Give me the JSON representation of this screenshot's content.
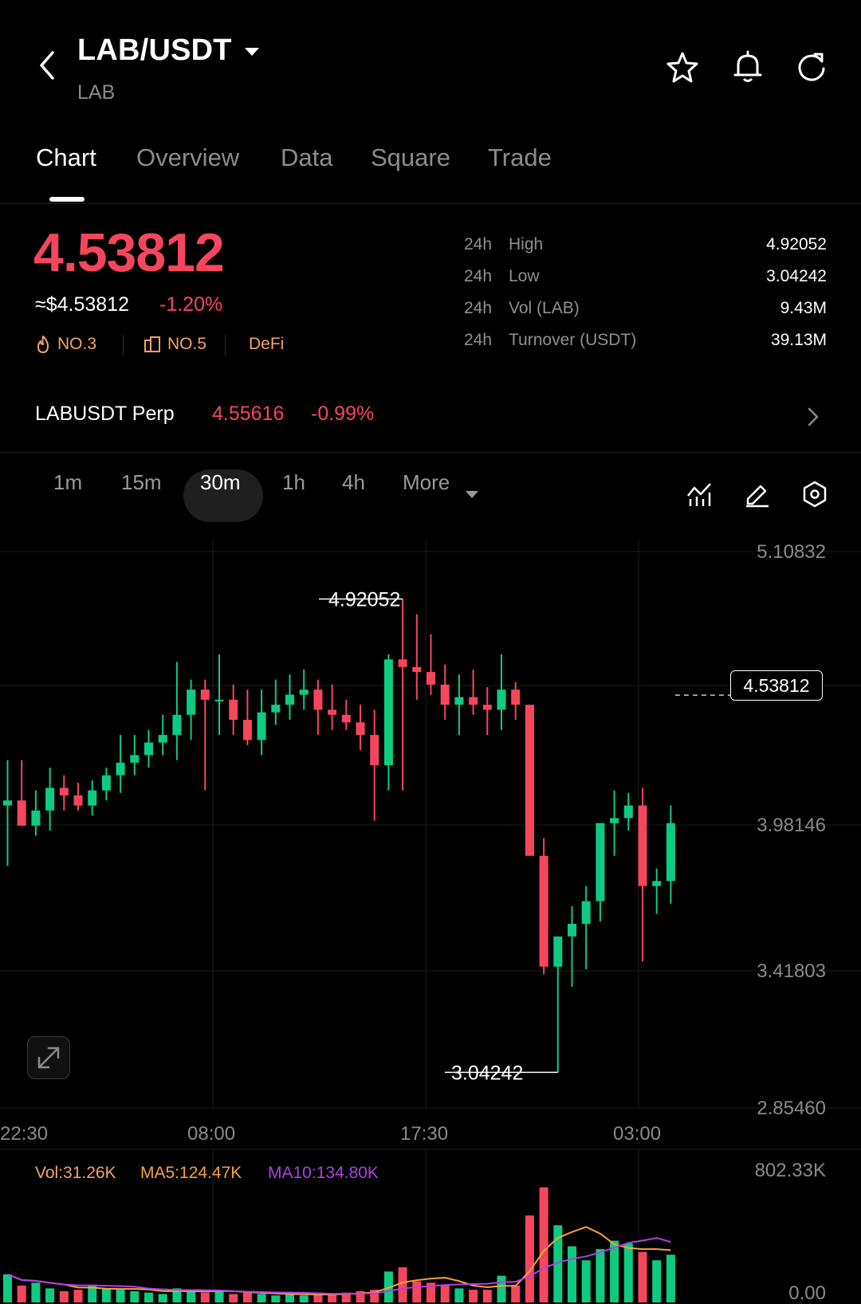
{
  "header": {
    "pair": "LAB/USDT",
    "base": "LAB",
    "icons": [
      "back-icon",
      "star-icon",
      "bell-icon",
      "refresh-icon"
    ]
  },
  "tabs": [
    "Chart",
    "Overview",
    "Data",
    "Square",
    "Trade"
  ],
  "active_tab": "Chart",
  "ticker": {
    "last": "4.53812",
    "usd": "≈$4.53812",
    "change": "-1.20%",
    "badges": [
      {
        "icon": "flame-icon",
        "label": "NO.3"
      },
      {
        "icon": "chart-box-icon",
        "label": "NO.5"
      },
      {
        "icon": "",
        "label": "DeFi"
      }
    ],
    "stats": [
      {
        "period": "24h",
        "label": "High",
        "value": "4.92052"
      },
      {
        "period": "24h",
        "label": "Low",
        "value": "3.04242"
      },
      {
        "period": "24h",
        "label": "Vol (LAB)",
        "value": "9.43M"
      },
      {
        "period": "24h",
        "label": "Turnover (USDT)",
        "value": "39.13M"
      }
    ]
  },
  "perp": {
    "name": "LABUSDT Perp",
    "price": "4.55616",
    "change": "-0.99%"
  },
  "timeframes": [
    "1m",
    "15m",
    "30m",
    "1h",
    "4h",
    "More"
  ],
  "active_timeframe": "30m",
  "colors": {
    "up": "#0ecb81",
    "down": "#f6465d",
    "bg": "#000000",
    "accent_badge": "#f2a36a",
    "ma5": "#f7a23b",
    "ma10": "#b13ee8"
  },
  "chart_data": [
    {
      "type": "candlestick",
      "y_ticks": [
        "5.10832",
        "3.98146",
        "3.41803",
        "2.85460"
      ],
      "x_ticks": [
        "22:30",
        "08:00",
        "17:30",
        "03:00"
      ],
      "ylim": [
        2.8546,
        5.10832
      ],
      "high_label": "4.92052",
      "low_label": "3.04242",
      "current_price": "4.53812",
      "grid": true,
      "candles": [
        [
          4.1,
          4.28,
          3.86,
          4.12
        ],
        [
          4.12,
          4.28,
          4.02,
          4.02
        ],
        [
          4.02,
          4.16,
          3.98,
          4.08
        ],
        [
          4.08,
          4.25,
          4.0,
          4.17
        ],
        [
          4.17,
          4.22,
          4.08,
          4.14
        ],
        [
          4.14,
          4.19,
          4.08,
          4.1
        ],
        [
          4.1,
          4.2,
          4.06,
          4.16
        ],
        [
          4.16,
          4.25,
          4.12,
          4.22
        ],
        [
          4.22,
          4.38,
          4.15,
          4.27
        ],
        [
          4.27,
          4.38,
          4.22,
          4.3
        ],
        [
          4.3,
          4.4,
          4.25,
          4.35
        ],
        [
          4.35,
          4.46,
          4.3,
          4.38
        ],
        [
          4.38,
          4.67,
          4.28,
          4.46
        ],
        [
          4.46,
          4.6,
          4.36,
          4.56
        ],
        [
          4.56,
          4.6,
          4.16,
          4.52
        ],
        [
          4.52,
          4.7,
          4.38,
          4.52
        ],
        [
          4.52,
          4.58,
          4.38,
          4.44
        ],
        [
          4.44,
          4.56,
          4.34,
          4.36
        ],
        [
          4.36,
          4.56,
          4.3,
          4.47
        ],
        [
          4.47,
          4.6,
          4.42,
          4.5
        ],
        [
          4.5,
          4.62,
          4.44,
          4.54
        ],
        [
          4.54,
          4.64,
          4.48,
          4.56
        ],
        [
          4.56,
          4.6,
          4.38,
          4.48
        ],
        [
          4.48,
          4.58,
          4.4,
          4.46
        ],
        [
          4.46,
          4.52,
          4.4,
          4.43
        ],
        [
          4.43,
          4.5,
          4.32,
          4.38
        ],
        [
          4.38,
          4.48,
          4.04,
          4.26
        ],
        [
          4.26,
          4.7,
          4.16,
          4.68
        ],
        [
          4.68,
          4.92,
          4.16,
          4.65
        ],
        [
          4.65,
          4.86,
          4.52,
          4.63
        ],
        [
          4.63,
          4.78,
          4.54,
          4.58
        ],
        [
          4.58,
          4.66,
          4.44,
          4.5
        ],
        [
          4.5,
          4.62,
          4.38,
          4.53
        ],
        [
          4.53,
          4.64,
          4.46,
          4.5
        ],
        [
          4.5,
          4.57,
          4.38,
          4.48
        ],
        [
          4.48,
          4.7,
          4.4,
          4.56
        ],
        [
          4.56,
          4.59,
          4.44,
          4.5
        ],
        [
          4.5,
          4.4,
          3.9,
          3.9
        ],
        [
          3.9,
          3.97,
          3.43,
          3.46
        ],
        [
          3.46,
          3.58,
          3.04,
          3.58
        ],
        [
          3.58,
          3.7,
          3.38,
          3.63
        ],
        [
          3.63,
          3.78,
          3.45,
          3.72
        ],
        [
          3.72,
          4.02,
          3.64,
          4.03
        ],
        [
          4.03,
          4.16,
          3.9,
          4.05
        ],
        [
          4.05,
          4.15,
          4.0,
          4.1
        ],
        [
          4.1,
          4.17,
          3.48,
          3.78
        ],
        [
          3.78,
          3.85,
          3.67,
          3.8
        ],
        [
          3.8,
          4.1,
          3.71,
          4.03
        ]
      ],
      "volumes": [
        [
          0.2
        ],
        [
          0.12
        ],
        [
          0.14
        ],
        [
          0.1
        ],
        [
          0.08
        ],
        [
          0.09
        ],
        [
          0.12
        ],
        [
          0.1
        ],
        [
          0.09
        ],
        [
          0.08
        ],
        [
          0.07
        ],
        [
          0.06
        ],
        [
          0.1
        ],
        [
          0.09
        ],
        [
          0.07
        ],
        [
          0.08
        ],
        [
          0.06
        ],
        [
          0.07
        ],
        [
          0.06
        ],
        [
          0.05
        ],
        [
          0.06
        ],
        [
          0.05
        ],
        [
          0.06
        ],
        [
          0.06
        ],
        [
          0.07
        ],
        [
          0.08
        ],
        [
          0.09
        ],
        [
          0.22
        ],
        [
          0.25
        ],
        [
          0.15
        ],
        [
          0.14
        ],
        [
          0.12
        ],
        [
          0.1
        ],
        [
          0.09
        ],
        [
          0.09
        ],
        [
          0.19
        ],
        [
          0.12
        ],
        [
          0.62
        ],
        [
          0.82
        ],
        [
          0.55
        ],
        [
          0.4
        ],
        [
          0.3
        ],
        [
          0.38
        ],
        [
          0.44
        ],
        [
          0.42
        ],
        [
          0.36
        ],
        [
          0.3
        ],
        [
          0.34
        ]
      ],
      "volume_axis": [
        "802.33K",
        "0.00"
      ],
      "volume_legend": {
        "vol": "Vol:31.26K",
        "ma5": "MA5:124.47K",
        "ma10": "MA10:134.80K"
      }
    }
  ]
}
